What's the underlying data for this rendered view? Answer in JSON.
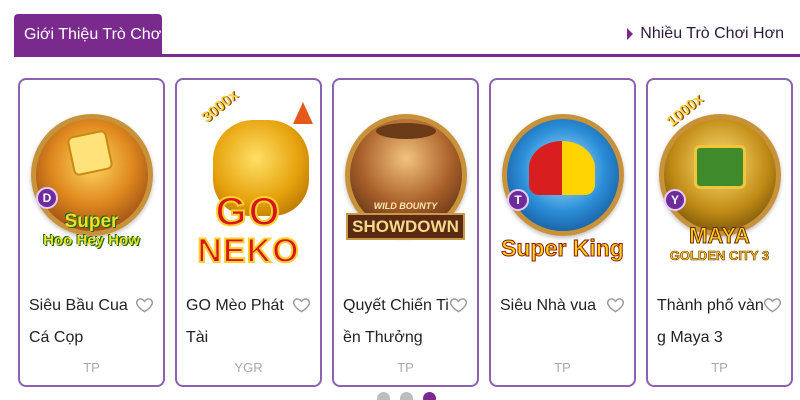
{
  "header": {
    "active_tab": "Giới Thiệu Trò Chơi",
    "more_link": "Nhiều Trò Chơi Hơn"
  },
  "colors": {
    "accent": "#7a2a8c",
    "card_border": "#8c62b0"
  },
  "games": [
    {
      "name": "Siêu Bầu Cua Cá Cọp",
      "provider": "TP",
      "badge": "D",
      "logo_lines": [
        "Super",
        "Hoo Hey How"
      ],
      "art": "gold dice disc",
      "icon": "heart-icon"
    },
    {
      "name": "GO Mèo Phát Tài",
      "provider": "YGR",
      "multiplier": "3000x",
      "logo_lines": [
        "GO",
        "NEKO"
      ],
      "art": "lucky cat",
      "icon": "heart-icon"
    },
    {
      "name": "Quyết Chiến Tiền Thưởng",
      "provider": "TP",
      "logo_lines": [
        "WILD BOUNTY",
        "SHOWDOWN"
      ],
      "art": "cowgirl disc",
      "icon": "heart-icon"
    },
    {
      "name": "Siêu Nhà vua",
      "provider": "TP",
      "badge": "T",
      "logo_lines": [
        "Super King"
      ],
      "art": "jester crown disc",
      "icon": "heart-icon"
    },
    {
      "name": "Thành phố vàng Maya 3",
      "provider": "TP",
      "badge": "Y",
      "multiplier": "1000x",
      "logo_lines": [
        "MAYA",
        "GOLDEN CITY 3"
      ],
      "art": "maya temple disc",
      "icon": "heart-icon"
    }
  ],
  "pagination": {
    "count": 3,
    "active_index": 2
  }
}
